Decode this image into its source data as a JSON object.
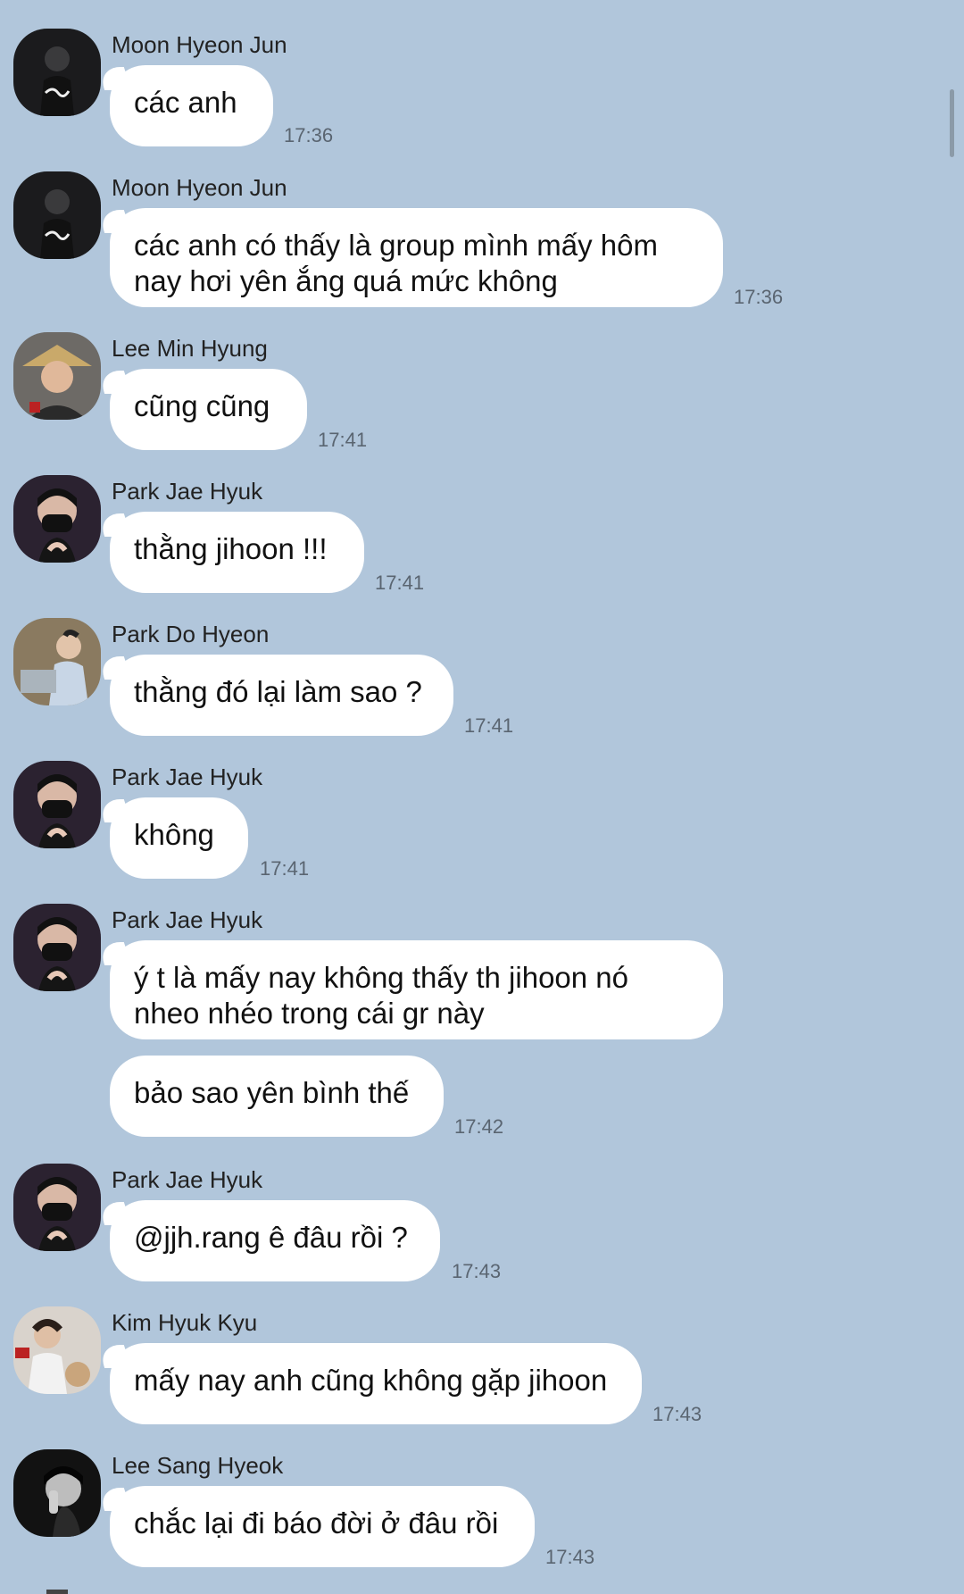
{
  "messages": [
    {
      "sender": "Moon Hyeon Jun",
      "avatar": "avatar-moon-hyeon-jun",
      "lines": [
        "các anh"
      ],
      "time": "17:36"
    },
    {
      "sender": "Moon Hyeon Jun",
      "avatar": "avatar-moon-hyeon-jun",
      "lines": [
        "các anh có thấy là group mình mấy hôm",
        "nay hơi yên ắng quá mức không"
      ],
      "time": "17:36"
    },
    {
      "sender": "Lee Min Hyung",
      "avatar": "avatar-lee-min-hyung",
      "lines": [
        "cũng cũng"
      ],
      "time": "17:41"
    },
    {
      "sender": "Park Jae Hyuk",
      "avatar": "avatar-park-jae-hyuk",
      "lines": [
        "thằng jihoon !!!"
      ],
      "time": "17:41"
    },
    {
      "sender": "Park Do Hyeon",
      "avatar": "avatar-park-do-hyeon",
      "lines": [
        "thằng đó lại làm sao ?"
      ],
      "time": "17:41"
    },
    {
      "sender": "Park Jae Hyuk",
      "avatar": "avatar-park-jae-hyuk",
      "lines": [
        "không"
      ],
      "time": "17:41"
    },
    {
      "sender": "Park Jae Hyuk",
      "avatar": "avatar-park-jae-hyuk",
      "lines": [
        "ý t là mấy nay không thấy th jihoon nó",
        "nheo nhéo trong cái gr này"
      ],
      "time": ""
    },
    {
      "sender": "",
      "avatar": "",
      "lines": [
        "bảo sao yên bình thế"
      ],
      "time": "17:42"
    },
    {
      "sender": "Park Jae Hyuk",
      "avatar": "avatar-park-jae-hyuk",
      "lines": [
        "@jjh.rang ê đâu rồi ?"
      ],
      "time": "17:43"
    },
    {
      "sender": "Kim Hyuk Kyu",
      "avatar": "avatar-kim-hyuk-kyu",
      "lines": [
        "mấy nay anh cũng không gặp jihoon"
      ],
      "time": "17:43"
    },
    {
      "sender": "Lee Sang Hyeok",
      "avatar": "avatar-lee-sang-hyeok",
      "lines": [
        "chắc lại đi báo đời ở đâu rồi"
      ],
      "time": "17:43"
    }
  ],
  "colors": {
    "background": "#b1c6db",
    "bubble": "#ffffff",
    "time": "#5a6571"
  }
}
